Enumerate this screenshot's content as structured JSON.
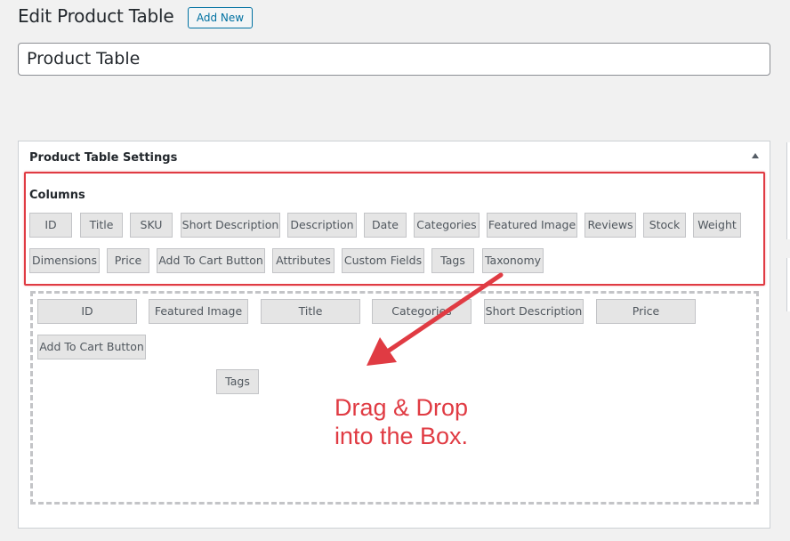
{
  "page": {
    "heading": "Edit Product Table",
    "add_new_label": "Add New",
    "title_value": "Product Table"
  },
  "settings": {
    "title": "Product Table Settings",
    "toggle_icon": "triangle-up-icon",
    "columns_label": "Columns",
    "available_columns": [
      "ID",
      "Title",
      "SKU",
      "Short Description",
      "Description",
      "Date",
      "Categories",
      "Featured Image",
      "Reviews",
      "Stock",
      "Weight",
      "Dimensions",
      "Price",
      "Add To Cart Button",
      "Attributes",
      "Custom Fields",
      "Tags",
      "Taxonomy"
    ],
    "selected_columns": [
      "ID",
      "Featured Image",
      "Title",
      "Categories",
      "Short Description",
      "Price",
      "Add To Cart Button",
      "Tags"
    ]
  },
  "annotation": {
    "line1": "Drag & Drop",
    "line2": "into the Box.",
    "color": "#e03b43"
  }
}
